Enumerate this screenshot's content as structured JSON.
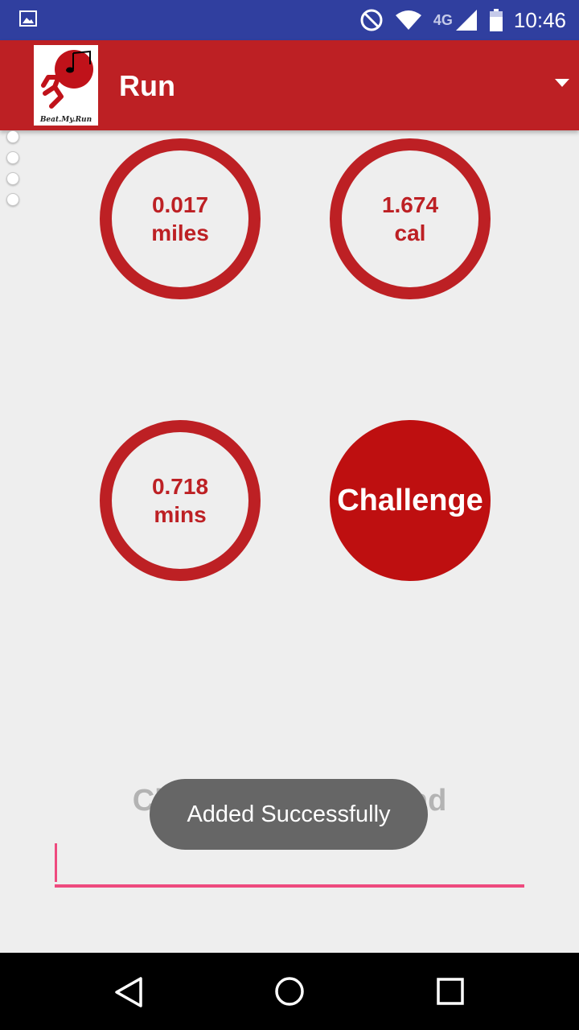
{
  "status_bar": {
    "time": "10:46",
    "network": "4G",
    "icons": [
      "gallery-icon",
      "do-not-disturb-icon",
      "wifi-icon",
      "cell-signal-icon",
      "battery-icon"
    ]
  },
  "app_bar": {
    "title": "Run",
    "logo_text": "Beat.My.Run",
    "color": "#bd2024"
  },
  "stats": {
    "distance": {
      "value": "0.017",
      "unit": "miles"
    },
    "calories": {
      "value": "1.674",
      "unit": "cal"
    },
    "time": {
      "value": "0.718",
      "unit": "mins"
    }
  },
  "challenge_button": {
    "label": "Challenge"
  },
  "friend_input": {
    "placeholder": "Challenge your friend",
    "value": ""
  },
  "toast": {
    "message": "Added Successfully"
  },
  "navigation": {
    "icons": [
      "back-icon",
      "home-icon",
      "recents-icon"
    ]
  }
}
